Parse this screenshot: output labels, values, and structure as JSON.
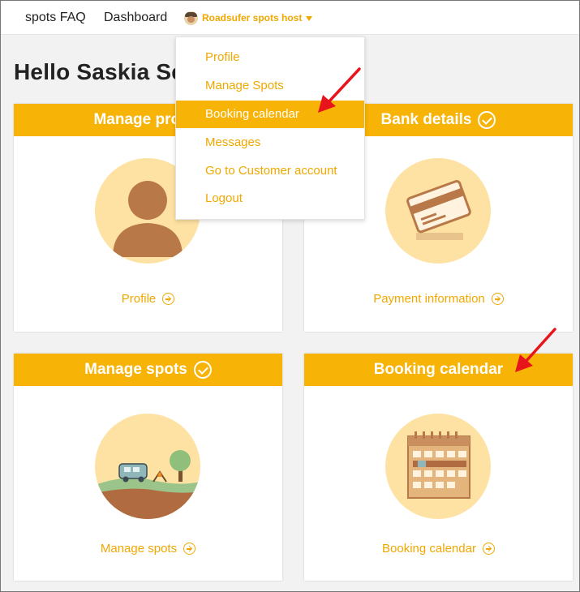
{
  "nav": {
    "faq": "spots FAQ",
    "dashboard": "Dashboard",
    "user": "Roadsufer spots host"
  },
  "greeting": "Hello Saskia Se",
  "dropdown": {
    "items": [
      {
        "label": "Profile"
      },
      {
        "label": "Manage Spots"
      },
      {
        "label": "Booking calendar",
        "active": true
      },
      {
        "label": "Messages"
      },
      {
        "label": "Go to Customer account"
      },
      {
        "label": "Logout"
      }
    ]
  },
  "cards": {
    "profile": {
      "title": "Manage profile",
      "link": "Profile"
    },
    "bank": {
      "title": "Bank details",
      "link": "Payment information",
      "checked": true
    },
    "spots": {
      "title": "Manage spots",
      "link": "Manage spots",
      "checked": true
    },
    "calendar": {
      "title": "Booking calendar",
      "link": "Booking calendar"
    }
  },
  "colors": {
    "accent": "#f7b306",
    "link": "#f0a800",
    "illustration_bg": "#fde2a3",
    "annotation_arrow": "#e8141c"
  },
  "icons": {
    "profile": "person-icon",
    "bank": "credit-card-icon",
    "spots": "campervan-landscape-icon",
    "calendar": "calendar-icon"
  }
}
